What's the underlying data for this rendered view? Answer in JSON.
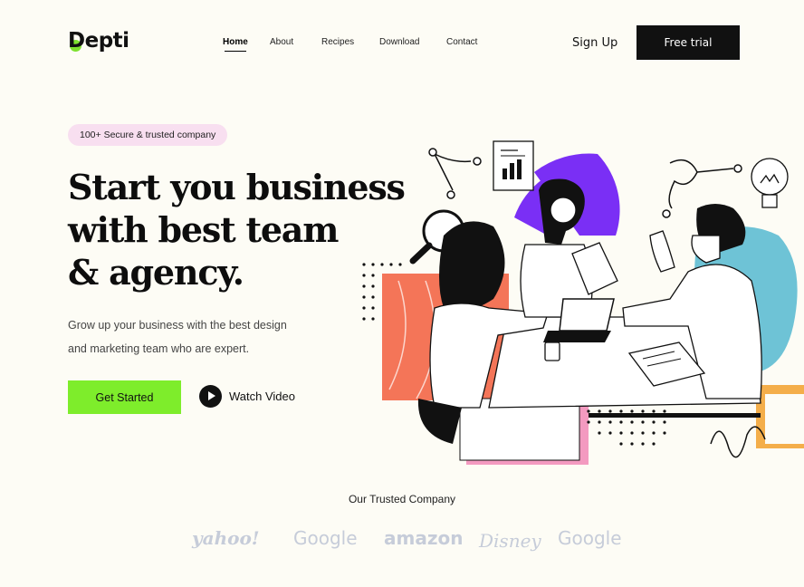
{
  "brand": {
    "name": "Depti",
    "accent": "#7ee12f"
  },
  "nav": {
    "items": [
      "Home",
      "About",
      "Recipes",
      "Download",
      "Contact"
    ],
    "active": "Home"
  },
  "header": {
    "signup_label": "Sign Up",
    "trial_label": "Free trial"
  },
  "hero": {
    "badge": "100+ Secure & trusted company",
    "headline": [
      "Start you business",
      "with best team",
      "& agency."
    ],
    "description": [
      "Grow up your business with the best design",
      "and marketing team who are expert."
    ],
    "cta_label": "Get Started",
    "video_label": "Watch Video"
  },
  "trusted": {
    "title": "Our Trusted Company",
    "logos": [
      "yahoo!",
      "Google",
      "amazon",
      "Disney",
      "Google"
    ]
  },
  "colors": {
    "background": "#fdfcf5",
    "cta": "#7eed2b",
    "badge": "#f8dff0",
    "dark": "#111111",
    "logo_gray": "#c6ccd9"
  }
}
